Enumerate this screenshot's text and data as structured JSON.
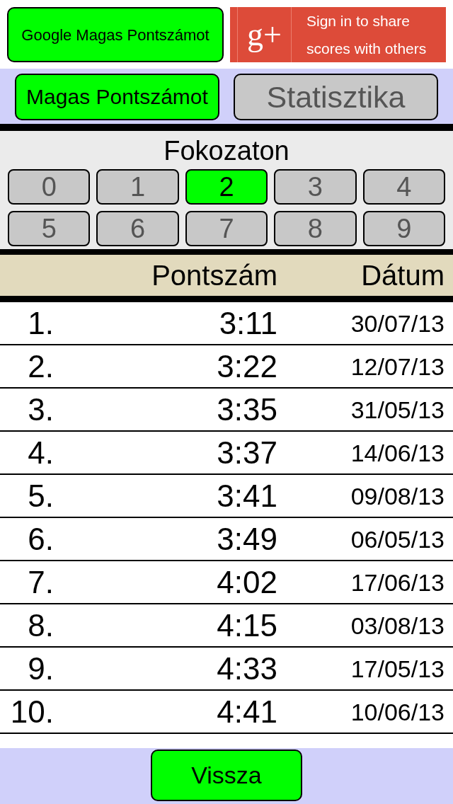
{
  "google_button": {
    "label": "Google Magas Pontszámot"
  },
  "sign_in_button": {
    "logo": "g+",
    "label": "Sign in to share scores with others"
  },
  "tabs": [
    {
      "label": "Magas Pontszámot",
      "selected": true
    },
    {
      "label": "Statisztika",
      "selected": false
    }
  ],
  "level_panel": {
    "title": "Fokozaton",
    "levels": [
      {
        "label": "0",
        "selected": false
      },
      {
        "label": "1",
        "selected": false
      },
      {
        "label": "2",
        "selected": true
      },
      {
        "label": "3",
        "selected": false
      },
      {
        "label": "4",
        "selected": false
      },
      {
        "label": "5",
        "selected": false
      },
      {
        "label": "6",
        "selected": false
      },
      {
        "label": "7",
        "selected": false
      },
      {
        "label": "8",
        "selected": false
      },
      {
        "label": "9",
        "selected": false
      }
    ]
  },
  "table": {
    "columns": [
      "Pontszám",
      "Dátum"
    ],
    "rows": [
      {
        "rank": "1.",
        "score": "3:11",
        "date": "30/07/13"
      },
      {
        "rank": "2.",
        "score": "3:22",
        "date": "12/07/13"
      },
      {
        "rank": "3.",
        "score": "3:35",
        "date": "31/05/13"
      },
      {
        "rank": "4.",
        "score": "3:37",
        "date": "14/06/13"
      },
      {
        "rank": "5.",
        "score": "3:41",
        "date": "09/08/13"
      },
      {
        "rank": "6.",
        "score": "3:49",
        "date": "06/05/13"
      },
      {
        "rank": "7.",
        "score": "4:02",
        "date": "17/06/13"
      },
      {
        "rank": "8.",
        "score": "4:15",
        "date": "03/08/13"
      },
      {
        "rank": "9.",
        "score": "4:33",
        "date": "17/05/13"
      },
      {
        "rank": "10.",
        "score": "4:41",
        "date": "10/06/13"
      }
    ]
  },
  "back_button": {
    "label": "Vissza"
  }
}
